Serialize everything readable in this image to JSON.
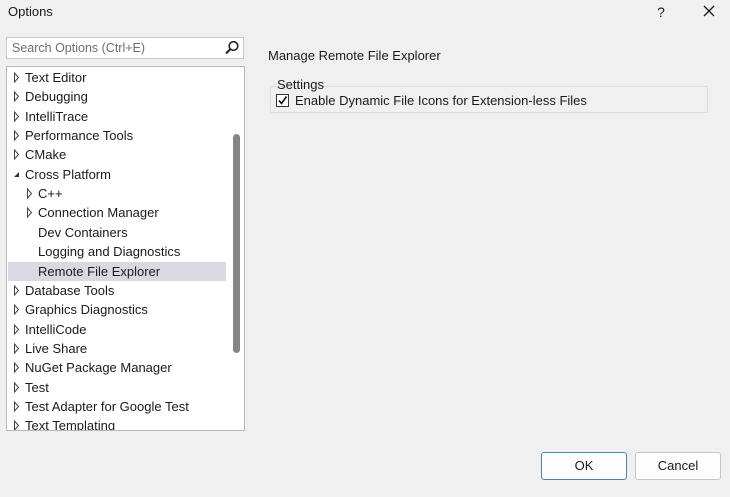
{
  "window": {
    "title": "Options",
    "help_label": "?"
  },
  "search": {
    "placeholder": "Search Options (Ctrl+E)",
    "value": ""
  },
  "tree": {
    "items": [
      {
        "label": "Text Editor",
        "expander": "collapsed",
        "level": 0,
        "selected": false
      },
      {
        "label": "Debugging",
        "expander": "collapsed",
        "level": 0,
        "selected": false
      },
      {
        "label": "IntelliTrace",
        "expander": "collapsed",
        "level": 0,
        "selected": false
      },
      {
        "label": "Performance Tools",
        "expander": "collapsed",
        "level": 0,
        "selected": false
      },
      {
        "label": "CMake",
        "expander": "collapsed",
        "level": 0,
        "selected": false
      },
      {
        "label": "Cross Platform",
        "expander": "expanded",
        "level": 0,
        "selected": false
      },
      {
        "label": "C++",
        "expander": "collapsed",
        "level": 1,
        "selected": false
      },
      {
        "label": "Connection Manager",
        "expander": "collapsed",
        "level": 1,
        "selected": false
      },
      {
        "label": "Dev Containers",
        "expander": "none",
        "level": 1,
        "selected": false
      },
      {
        "label": "Logging and Diagnostics",
        "expander": "none",
        "level": 1,
        "selected": false
      },
      {
        "label": "Remote File Explorer",
        "expander": "none",
        "level": 1,
        "selected": true
      },
      {
        "label": "Database Tools",
        "expander": "collapsed",
        "level": 0,
        "selected": false
      },
      {
        "label": "Graphics Diagnostics",
        "expander": "collapsed",
        "level": 0,
        "selected": false
      },
      {
        "label": "IntelliCode",
        "expander": "collapsed",
        "level": 0,
        "selected": false
      },
      {
        "label": "Live Share",
        "expander": "collapsed",
        "level": 0,
        "selected": false
      },
      {
        "label": "NuGet Package Manager",
        "expander": "collapsed",
        "level": 0,
        "selected": false
      },
      {
        "label": "Test",
        "expander": "collapsed",
        "level": 0,
        "selected": false
      },
      {
        "label": "Test Adapter for Google Test",
        "expander": "collapsed",
        "level": 0,
        "selected": false
      },
      {
        "label": "Text Templating",
        "expander": "collapsed",
        "level": 0,
        "selected": false
      }
    ]
  },
  "page": {
    "title": "Manage Remote File Explorer",
    "group_label": "Settings",
    "checkbox_label": "Enable Dynamic File Icons for Extension-less Files",
    "checkbox_checked": true
  },
  "buttons": {
    "ok_label": "OK",
    "cancel_label": "Cancel"
  },
  "colors": {
    "selection": "#d9d9e3",
    "ok_border": "#3f83d1",
    "background": "#f0f0f0"
  }
}
